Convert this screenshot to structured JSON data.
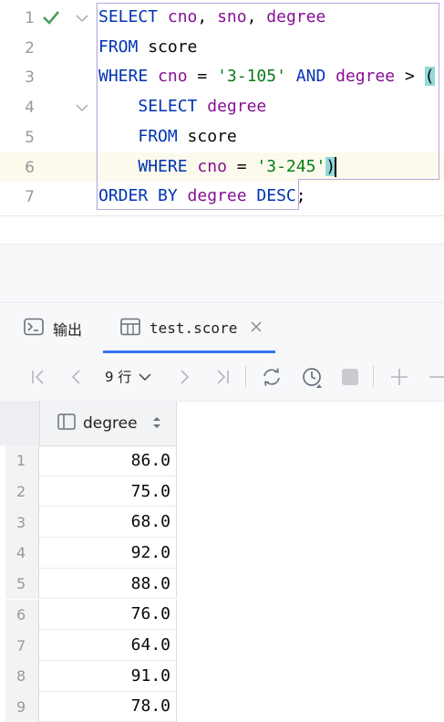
{
  "editor": {
    "line_numbers": [
      "1",
      "2",
      "3",
      "4",
      "5",
      "6",
      "7"
    ],
    "lines": [
      [
        {
          "t": "SELECT",
          "c": "k"
        },
        {
          "t": " ",
          "c": "p"
        },
        {
          "t": "cno",
          "c": "f"
        },
        {
          "t": ", ",
          "c": "p"
        },
        {
          "t": "sno",
          "c": "f"
        },
        {
          "t": ", ",
          "c": "p"
        },
        {
          "t": "degree",
          "c": "f"
        }
      ],
      [
        {
          "t": "FROM",
          "c": "k"
        },
        {
          "t": " score",
          "c": "p"
        }
      ],
      [
        {
          "t": "WHERE",
          "c": "k"
        },
        {
          "t": " ",
          "c": "p"
        },
        {
          "t": "cno",
          "c": "f"
        },
        {
          "t": " = ",
          "c": "p"
        },
        {
          "t": "'3-105'",
          "c": "s"
        },
        {
          "t": " ",
          "c": "p"
        },
        {
          "t": "AND",
          "c": "k"
        },
        {
          "t": " ",
          "c": "p"
        },
        {
          "t": "degree",
          "c": "f"
        },
        {
          "t": " > ",
          "c": "p"
        },
        {
          "t": "(",
          "c": "hl"
        }
      ],
      [
        {
          "t": "    ",
          "c": "p"
        },
        {
          "t": "SELECT",
          "c": "k"
        },
        {
          "t": " ",
          "c": "p"
        },
        {
          "t": "degree",
          "c": "f"
        }
      ],
      [
        {
          "t": "    ",
          "c": "p"
        },
        {
          "t": "FROM",
          "c": "k"
        },
        {
          "t": " score",
          "c": "p"
        }
      ],
      [
        {
          "t": "    ",
          "c": "p"
        },
        {
          "t": "WHERE",
          "c": "k"
        },
        {
          "t": " ",
          "c": "p"
        },
        {
          "t": "cno",
          "c": "f"
        },
        {
          "t": " = ",
          "c": "p"
        },
        {
          "t": "'3-245'",
          "c": "s"
        },
        {
          "t": ")",
          "c": "hl"
        }
      ],
      [
        {
          "t": "ORDER BY",
          "c": "k"
        },
        {
          "t": " ",
          "c": "p"
        },
        {
          "t": "degree",
          "c": "f"
        },
        {
          "t": " ",
          "c": "p"
        },
        {
          "t": "DESC",
          "c": "k"
        },
        {
          "t": ";",
          "c": "p"
        }
      ]
    ],
    "current_line": 6,
    "colors": {
      "keyword": "#0033b3",
      "field": "#871094",
      "string": "#067d17",
      "check": "#4a9c5d"
    }
  },
  "tabs": [
    {
      "label": "输出",
      "icon": "console-icon",
      "active": false
    },
    {
      "label": "test.score",
      "icon": "table-icon",
      "active": true,
      "closable": true
    }
  ],
  "toolbar": {
    "rows_label": "9 行",
    "buttons": [
      "first-page-icon",
      "prev-page-icon",
      "next-page-icon",
      "last-page-icon",
      "refresh-icon",
      "history-icon",
      "stop-icon",
      "add-row-icon",
      "remove-row-icon"
    ]
  },
  "grid": {
    "column": "degree",
    "rows": [
      {
        "n": "1",
        "v": "86.0"
      },
      {
        "n": "2",
        "v": "75.0"
      },
      {
        "n": "3",
        "v": "68.0"
      },
      {
        "n": "4",
        "v": "92.0"
      },
      {
        "n": "5",
        "v": "88.0"
      },
      {
        "n": "6",
        "v": "76.0"
      },
      {
        "n": "7",
        "v": "64.0"
      },
      {
        "n": "8",
        "v": "91.0"
      },
      {
        "n": "9",
        "v": "78.0"
      }
    ]
  }
}
